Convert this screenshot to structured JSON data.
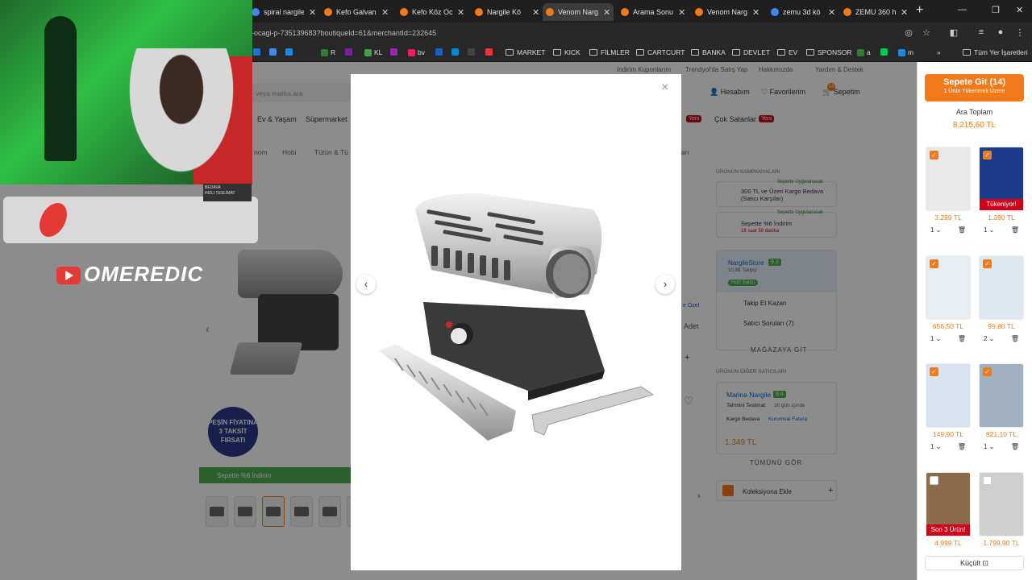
{
  "browser": {
    "tabs": [
      {
        "title": "spiral nargile",
        "color": "#4285f4"
      },
      {
        "title": "Kefo Galvaniz",
        "color": "#f27a1a"
      },
      {
        "title": "Kefo Köz Oca",
        "color": "#f27a1a"
      },
      {
        "title": "Nargile Kö",
        "color": "#f27a1a"
      },
      {
        "title": "Venom Narg",
        "color": "#f27a1a",
        "active": true
      },
      {
        "title": "Arama Sonuç",
        "color": "#f27a1a"
      },
      {
        "title": "Venom Narg",
        "color": "#f27a1a"
      },
      {
        "title": "zemu 3d kö",
        "color": "#4285f4"
      },
      {
        "title": "ZEMU 360 h",
        "color": "#f27a1a"
      }
    ],
    "new_tab": "+",
    "url": "-ocagi-p-735139683?boutiqueId=61&merchantId=232645",
    "bookmarks": [
      "",
      "",
      "",
      "R",
      "",
      "KL",
      "",
      "bv",
      "",
      "",
      "",
      "",
      "MARKET",
      "KICK",
      "FİLMLER",
      "CARTCURT",
      "BANKA",
      "DEVLET",
      "EV",
      "SPONSOR",
      "a",
      "",
      "m"
    ],
    "all_bookmarks": "Tüm Yer İşaretleri"
  },
  "site": {
    "top_links": [
      "İndirim Kuponlarım",
      "Trendyol'da Satış Yap",
      "Hakkımızda",
      "Yardım & Destek"
    ],
    "search_placeholder": "veya marka ara",
    "account": "Hesabım",
    "favorites": "Favorilerim",
    "cart": "Sepetim",
    "cart_count": "14",
    "categories": [
      "Ev & Yaşam",
      "Süpermarket",
      "Çok Satanlar"
    ],
    "new_badge": "Yeni",
    "breadcrumb": [
      "nom",
      "Hobi",
      "Tütün & Tü"
    ],
    "breadcrumb_tail": "arı",
    "campaigns_title": "ÜRÜNÜN KAMPANYALARI",
    "campaign1_tag": "Sepette Uygulanacak",
    "campaign1": "300 TL ve Üzeri Kargo Bedava (Satıcı Karşılar)",
    "campaign2_tag": "Sepette Uygulanacak",
    "campaign2": "Sepette %6 İndirim",
    "campaign2_time": "18 saat 59 dakika",
    "store_name": "NargileStore",
    "store_score": "9.3",
    "store_followers": "10,8B Takipçi",
    "fast_seller": "Hızlı Satıcı",
    "follow_win": "Takip Et Kazan",
    "seller_questions": "Satıcı Soruları (7)",
    "go_store": "MAĞAZAYA GİT",
    "other_sellers_title": "ÜRÜNÜN DİĞER SATICILARI",
    "other_seller": "Marina Nargile",
    "other_score": "9.4",
    "est_delivery_label": "Tahmini Teslimat:",
    "est_delivery": "30 gün içinde",
    "free_cargo": "Kargo Bedava",
    "corporate_invoice": "Kurumsal Fatura",
    "other_price": "1.349 TL",
    "see_all": "TÜMÜNÜ GÖR",
    "add_collection": "Koleksiyona Ekle",
    "discount_banner": "Sepette %6 İndirim",
    "installment_badge": "PEŞİN FİYATINA 3 TAKSİT FIRSATI",
    "adet": "Adet",
    "ozel": "e Özel",
    "cargo_fragment": "BEDAVA",
    "delivery_fragment": "HIZLI TESLİMAT"
  },
  "overlay": {
    "channel": "OMEREDIC"
  },
  "modal": {
    "close": "×",
    "prev": "‹",
    "next": "›"
  },
  "cart_panel": {
    "button_title": "Sepete Git (14)",
    "button_sub": "1 Ürün Tükenmek Üzere",
    "subtotal_label": "Ara Toplam",
    "subtotal": "8.215,60 TL",
    "items": [
      {
        "price": "3.299 TL",
        "qty": "1",
        "checked": true,
        "tag": ""
      },
      {
        "price": "1.390 TL",
        "qty": "1",
        "checked": true,
        "tag": "Tükeniyor!"
      },
      {
        "price": "656,50 TL",
        "qty": "1",
        "checked": true,
        "tag": ""
      },
      {
        "price": "99,80 TL",
        "qty": "2",
        "checked": true,
        "tag": ""
      },
      {
        "price": "149,90 TL",
        "qty": "1",
        "checked": true,
        "tag": ""
      },
      {
        "price": "821,10 TL",
        "qty": "1",
        "checked": true,
        "tag": ""
      },
      {
        "price": "4.999 TL",
        "qty": "",
        "checked": false,
        "tag": "Son 3 Ürün!"
      },
      {
        "price": "1.799,90 TL",
        "qty": "",
        "checked": false,
        "tag": ""
      }
    ],
    "shrink": "Küçült"
  }
}
